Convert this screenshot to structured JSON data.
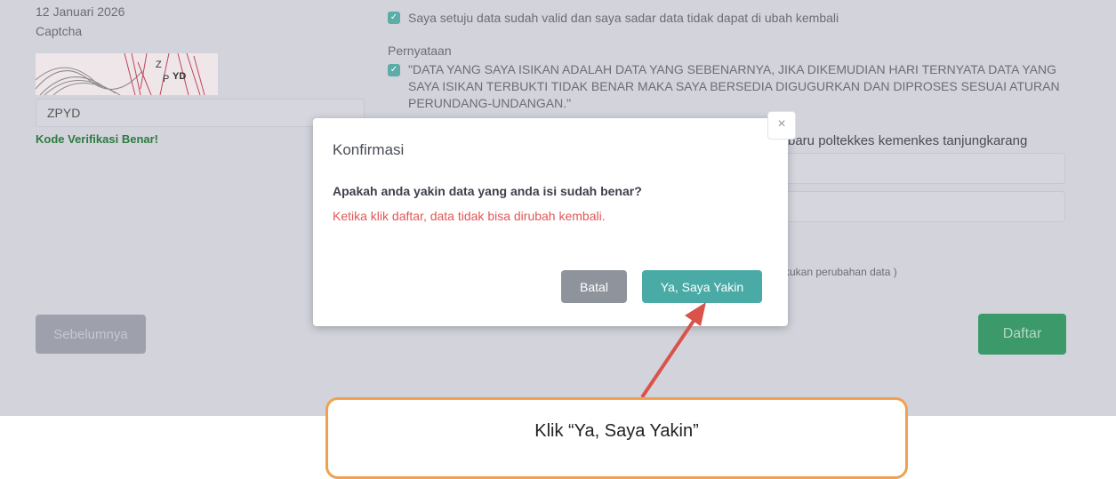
{
  "form": {
    "date": "12 Januari 2026",
    "captcha_label": "Captcha",
    "captcha_chars": [
      "Z",
      "P",
      "YD"
    ],
    "captcha_input": "ZPYD",
    "captcha_status": "Kode Verifikasi Benar!",
    "agree_text": "Saya setuju data sudah valid dan saya sadar data tidak dapat di ubah kembali",
    "statement_label": "Pernyataan",
    "statement_text": "\"DATA YANG SAYA ISIKAN ADALAH DATA YANG SEBENARNYA, JIKA DIKEMUDIAN HARI TERNYATA DATA YANG SAYA ISIKAN TERBUKTI TIDAK BENAR MAKA SAYA BERSEDIA DIGUGURKAN DAN DIPROSES SESUAI ATURAN PERUNDANG-UNDANGAN.\"",
    "partial_label": "baru poltekkes kemenkes tanjungkarang",
    "partial_note": "kukan perubahan data )",
    "prev_button": "Sebelumnya",
    "submit_button": "Daftar"
  },
  "modal": {
    "title": "Konfirmasi",
    "question": "Apakah anda yakin data yang anda isi sudah benar?",
    "warning": "Ketika klik daftar, data tidak bisa dirubah kembali.",
    "cancel_button": "Batal",
    "confirm_button": "Ya, Saya Yakin",
    "close_symbol": "×"
  },
  "callout": {
    "text": "Klik “Ya, Saya Yakin”"
  },
  "colors": {
    "accent": "#4aaba6",
    "warning": "#e15656",
    "success": "#2e7a3f",
    "callout_border": "#f0a14f",
    "arrow": "#d9534a"
  }
}
